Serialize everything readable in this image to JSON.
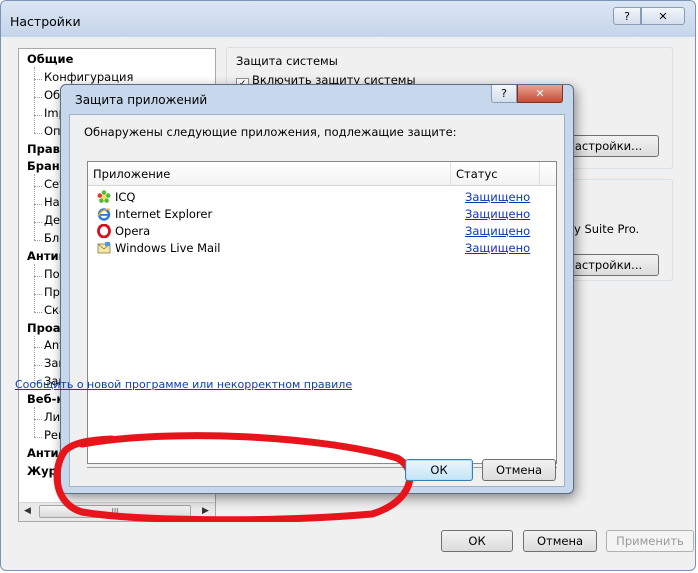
{
  "main": {
    "title": "Настройки",
    "help_btn": "?",
    "close_btn": "✕",
    "tree": [
      {
        "label": "Общие",
        "bold": true
      },
      {
        "label": "Конфигурация",
        "bold": false
      },
      {
        "label": "Обн",
        "bold": false
      },
      {
        "label": "Impr",
        "bold": false
      },
      {
        "label": "Опо",
        "bold": false
      },
      {
        "label": "Правил",
        "bold": true
      },
      {
        "label": "Брандм",
        "bold": true
      },
      {
        "label": "Сете",
        "bold": false
      },
      {
        "label": "Наст",
        "bold": false
      },
      {
        "label": "Дете",
        "bold": false
      },
      {
        "label": "Блок",
        "bold": false
      },
      {
        "label": "Антиви",
        "bold": true
      },
      {
        "label": "Пост",
        "bold": false
      },
      {
        "label": "Про",
        "bold": false
      },
      {
        "label": "Скан",
        "bold": false
      },
      {
        "label": "Проакт",
        "bold": true
      },
      {
        "label": "Anti",
        "bold": false
      },
      {
        "label": "Защ",
        "bold": false
      },
      {
        "label": "Защ",
        "bold": false
      },
      {
        "label": "Веб-ко",
        "bold": true
      },
      {
        "label": "Личн",
        "bold": false
      },
      {
        "label": "Рекл",
        "bold": false
      },
      {
        "label": "Антис",
        "bold": true
      },
      {
        "label": "Журн",
        "bold": true
      }
    ],
    "scroll_thumb_glyph": "III",
    "protect_group_title": "Защита системы",
    "enable_protect_label": "Включить защиту системы",
    "settings_btn_1": "астройки...",
    "suite_text": "y Suite Pro.",
    "settings_btn_2": "астройки...",
    "ok_btn": "ОК",
    "cancel_btn": "Отмена",
    "apply_btn": "Применить"
  },
  "dialog": {
    "title": "Защита приложений",
    "help_btn": "?",
    "close_btn": "✕",
    "description": "Обнаружены следующие приложения, подлежащие защите:",
    "columns": {
      "app": "Приложение",
      "status": "Статус"
    },
    "apps": [
      {
        "name": "ICQ",
        "status": "Защищено",
        "icon": "icq-flower-icon"
      },
      {
        "name": "Internet Explorer",
        "status": "Защищено",
        "icon": "internet-explorer-icon"
      },
      {
        "name": "Opera",
        "status": "Защищено",
        "icon": "opera-icon"
      },
      {
        "name": "Windows Live Mail",
        "status": "Защищено",
        "icon": "windows-live-mail-icon"
      }
    ],
    "report_link": "Сообщить о новой программе или некорректном правиле",
    "ok_btn": "ОК",
    "cancel_btn": "Отмена"
  },
  "annotation_color": "#e8141b"
}
